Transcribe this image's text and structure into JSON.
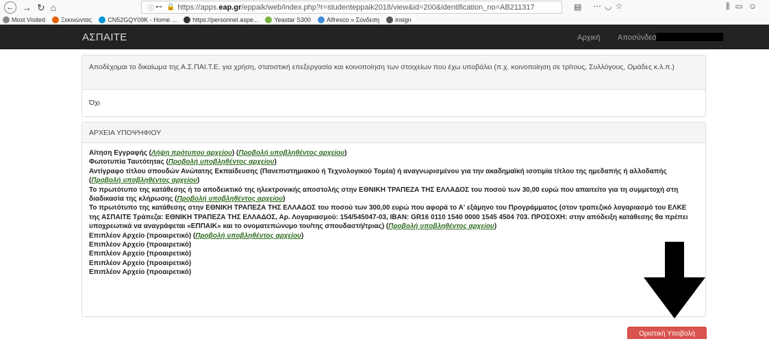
{
  "browser": {
    "url_prefix": "https://apps.",
    "url_host": "eap.gr",
    "url_rest": "/eppaik/web/index.php?r=studenteppaik2018/view&id=200&identification_no=AB211317",
    "bookmarks": [
      {
        "label": "Most Visited",
        "icon": "gear-icon",
        "color": "#888"
      },
      {
        "label": "Ξεκινώντας",
        "icon": "firefox-icon",
        "color": "#e66000"
      },
      {
        "label": "CN52GQY09K - Home ...",
        "icon": "hp-icon",
        "color": "#0096d6"
      },
      {
        "label": "https://personnel.aspe...",
        "icon": "people-icon",
        "color": "#333"
      },
      {
        "label": "Yeastar S300",
        "icon": "star-icon",
        "color": "#7cb342"
      },
      {
        "label": "Alfresco » Σύνδεση",
        "icon": "alfresco-icon",
        "color": "#3f8fd8"
      },
      {
        "label": "insign",
        "icon": "globe-icon",
        "color": "#555"
      }
    ]
  },
  "app": {
    "brand": "ΑΣΠΑΙΤΕ",
    "nav_home": "Αρχική",
    "nav_logout": "Αποσύνδεση"
  },
  "consent": {
    "question": "Αποδέχομαι το δικαίωμα της Α.Σ.ΠΑΙ.Τ.Ε. για χρήση, στατιστική επεξεργασία και κοινοποίηση των στοιχείων που έχω υποβάλει (π.χ. κοινοποίηση σε τρίτους, Συλλόγους, Ομάδες κ.λ.π.)",
    "answer": "Όχι"
  },
  "files": {
    "heading": "ΑΡΧΕΙΑ ΥΠΟΨΗΦΙΟΥ",
    "view_label": "Προβολή υποβληθέντος αρχείου",
    "template_label": "Λήψη πρότυπου αρχείου",
    "items": [
      {
        "text": "Αίτηση Εγγραφής"
      },
      {
        "text": "Φωτοτυπία Ταυτότητας"
      },
      {
        "text": "Αντίγραφο τίτλου σπουδών Ανώτατης Εκπαίδευσης (Πανεπιστημιακού ή Τεχνολογικού Τομέα) ή αναγνωρισμένου για την ακαδημαϊκή ισοτιμία τίτλου της ημεδαπής ή αλλοδαπής"
      },
      {
        "text": "Το πρωτότυπο της κατάθεσης ή το αποδεικτικό της ηλεκτρονικής αποστολής στην ΕΘΝΙΚΗ ΤΡΑΠΕΖΑ ΤΗΣ ΕΛΛΑΔΟΣ του ποσού των 30,00 ευρώ που απαιτείτο για τη συμμετοχή στη διαδικασία της κλήρωσης"
      },
      {
        "text": "Το πρωτότυπο της κατάθεσης στην ΕΘΝΙΚΗ ΤΡΑΠΕΖΑ ΤΗΣ ΕΛΛΑΔΟΣ του ποσού των 300,00 ευρώ που αφορά το Α' εξάμηνο του Προγράμματος (στον τραπεζικό λογαριασμό του ΕΛΚΕ της ΑΣΠΑΙΤΕ Τράπεζα: ΕΘΝΙΚΗ ΤΡΑΠΕΖΑ ΤΗΣ ΕΛΛΑΔΟΣ, Αρ. Λογαριασμού: 154/545047-03, IBAN: GR16 0110 1540 0000 1545 4504 703. ΠΡΟΣΟΧΗ: στην απόδειξη κατάθεσης θα πρέπει υποχρεωτικά να αναγράφεται «ΕΠΠΑΙΚ» και το ονοματεπώνυμο του/της σπουδαστή/τριας)"
      },
      {
        "text": "Επιπλέον Αρχείο (προαιρετικό)"
      },
      {
        "text": "Επιπλέον Αρχείο (προαιρετικό)"
      },
      {
        "text": "Επιπλέον Αρχείο (προαιρετικό)"
      },
      {
        "text": "Επιπλέον Αρχείο (προαιρετικό)"
      },
      {
        "text": "Επιπλέον Αρχείο (προαιρετικό)"
      }
    ]
  },
  "submit_label": "Οριστική Υποβολή"
}
